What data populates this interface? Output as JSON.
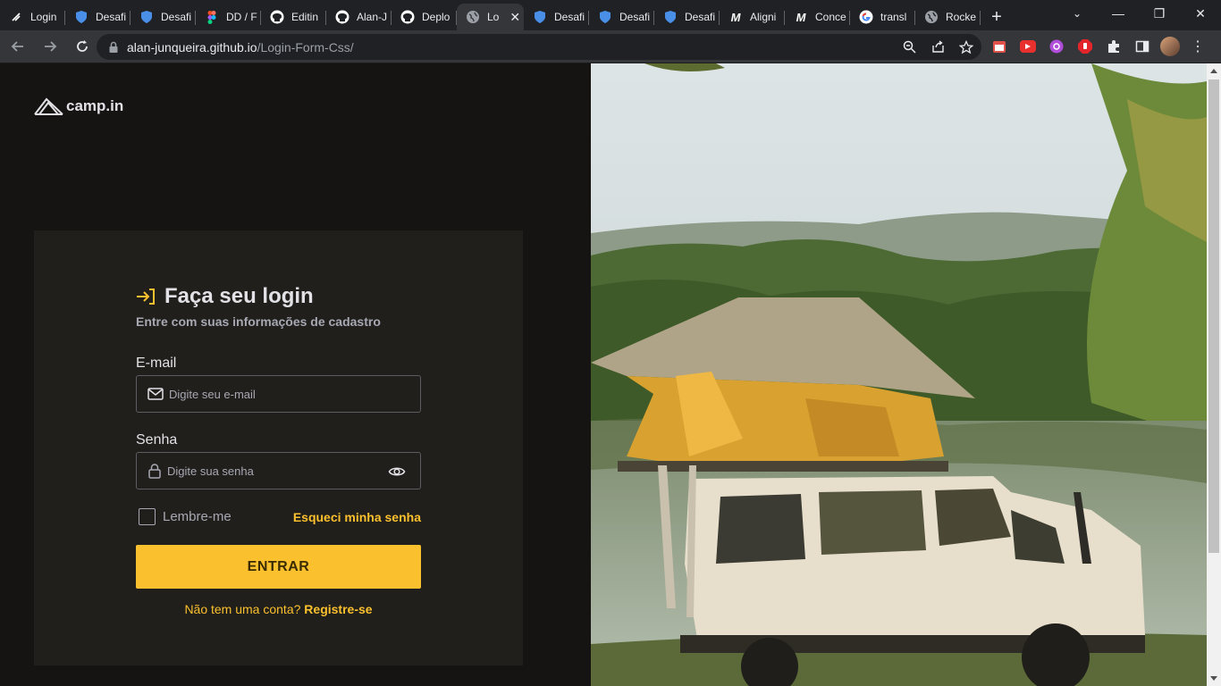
{
  "browser": {
    "tabs": [
      {
        "title": "Login",
        "icon": "rocketseat-icon"
      },
      {
        "title": "Desafi",
        "icon": "shield-icon"
      },
      {
        "title": "Desafi",
        "icon": "shield-icon"
      },
      {
        "title": "DD / F",
        "icon": "figma-icon"
      },
      {
        "title": "Editin",
        "icon": "github-icon"
      },
      {
        "title": "Alan-J",
        "icon": "github-icon"
      },
      {
        "title": "Deplo",
        "icon": "github-icon"
      },
      {
        "title": "Lo",
        "icon": "globe-icon",
        "active": true
      },
      {
        "title": "Desafi",
        "icon": "shield-icon"
      },
      {
        "title": "Desafi",
        "icon": "shield-icon"
      },
      {
        "title": "Desafi",
        "icon": "shield-icon"
      },
      {
        "title": "Aligni",
        "icon": "m-icon"
      },
      {
        "title": "Conce",
        "icon": "m-icon"
      },
      {
        "title": "transl",
        "icon": "google-icon"
      },
      {
        "title": "Rocke",
        "icon": "globe-icon"
      }
    ],
    "url_host": "alan-junqueira.github.io",
    "url_path": "/Login-Form-Css/"
  },
  "page": {
    "logo_text": "camp.in",
    "title": "Faça seu login",
    "subtitle": "Entre com suas informações de cadastro",
    "email_label": "E-mail",
    "email_placeholder": "Digite seu e-mail",
    "password_label": "Senha",
    "password_placeholder": "Digite sua senha",
    "remember_label": "Lembre-me",
    "forgot_link": "Esqueci minha senha",
    "submit_label": "ENTRAR",
    "signup_prompt": "Não tem uma conta?",
    "signup_link": "Registre-se"
  },
  "colors": {
    "accent": "#fbc02d",
    "background": "#151413",
    "card": "#201f1c"
  }
}
